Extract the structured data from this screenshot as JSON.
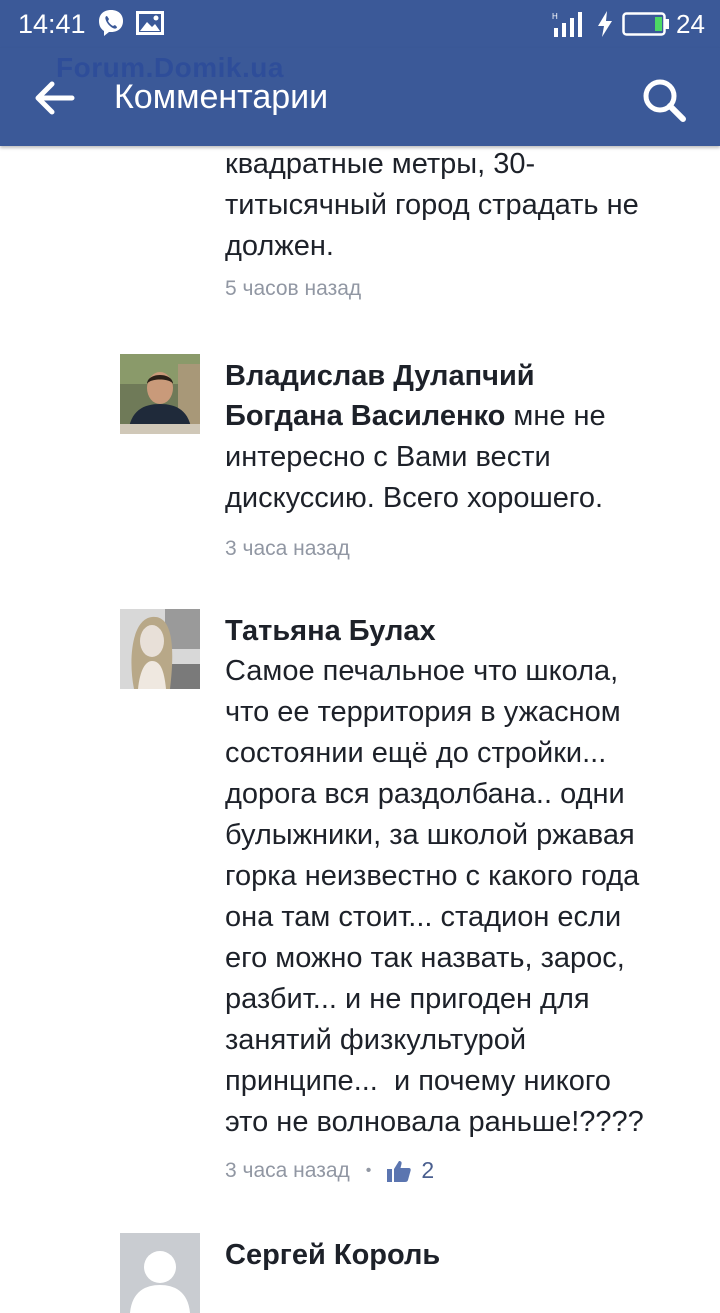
{
  "status_bar": {
    "time": "14:41",
    "battery_level": "24",
    "icons": [
      "viber-icon",
      "gallery-icon",
      "signal-icon",
      "charging-icon",
      "battery-icon"
    ]
  },
  "app_bar": {
    "watermark": "Forum.Domik.ua",
    "title": "Комментарии",
    "colors": {
      "background": "#3b5998",
      "text": "#ffffff"
    }
  },
  "comments": [
    {
      "author": "",
      "text": "квадратные метры, 30-\nтитысячный город страдать не\nдолжен.",
      "time": "5 часов назад"
    },
    {
      "author": "Владислав Дулапчий",
      "mention": "Богдана Василенко",
      "text": " мне не\nинтересно с Вами вести\nдискуссию. Всего хорошего.",
      "time": "3 часа назад"
    },
    {
      "author": "Татьяна Булах",
      "text": "Самое печальное что школа,\nчто ее территория в ужасном\nсостоянии ещё до стройки...\nдорога вся раздолбана.. одни\nбулыжники, за школой ржавая\nгорка неизвестно с какого года\nона там стоит... стадион если\nего можно так назвать, зарос,\nразбит... и не пригоден для\nзанятий физкультурой\nпринципе...  и почему никого\nэто не волновала раньше!????",
      "time": "3 часа назад",
      "separator": "•",
      "likes": "2"
    },
    {
      "author": "Сергей Король"
    }
  ]
}
